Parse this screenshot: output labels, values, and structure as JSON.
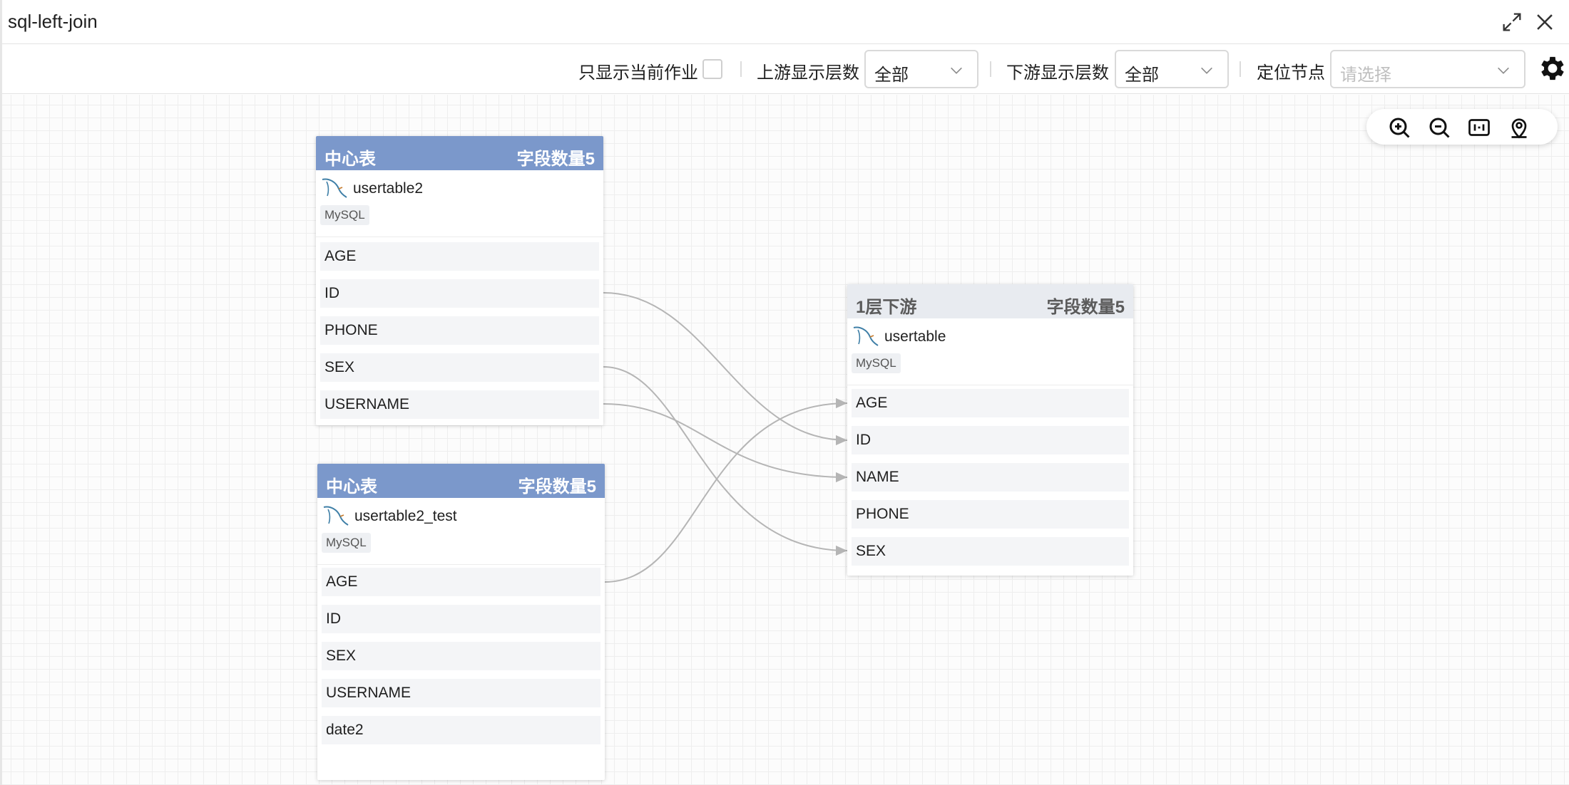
{
  "window": {
    "title": "sql-left-join"
  },
  "toolbar": {
    "only_current_job_label": "只显示当前作业",
    "only_current_job_checked": false,
    "upstream_levels_label": "上游显示层数",
    "upstream_levels_value": "全部",
    "downstream_levels_label": "下游显示层数",
    "downstream_levels_value": "全部",
    "locate_node_label": "定位节点",
    "locate_node_placeholder": "请选择"
  },
  "icons": {
    "fullscreen": "expand-icon",
    "close": "close-icon",
    "settings": "gear-icon",
    "zoom_in": "zoom-in-icon",
    "zoom_out": "zoom-out-icon",
    "fit": "fit-view-icon",
    "locate": "location-pin-icon",
    "db": "mysql-dolphin-icon"
  },
  "colors": {
    "center_header": "#7b98cb",
    "downstream_header": "#e8ebf0",
    "edge": "#b5b5b5"
  },
  "nodes": [
    {
      "role_label": "中心表",
      "field_count_label": "字段数量5",
      "table_name": "usertable2",
      "db_type": "MySQL",
      "fields": [
        "AGE",
        "ID",
        "PHONE",
        "SEX",
        "USERNAME"
      ]
    },
    {
      "role_label": "中心表",
      "field_count_label": "字段数量5",
      "table_name": "usertable2_test",
      "db_type": "MySQL",
      "fields": [
        "AGE",
        "ID",
        "SEX",
        "USERNAME",
        "date2"
      ]
    },
    {
      "role_label": "1层下游",
      "field_count_label": "字段数量5",
      "table_name": "usertable",
      "db_type": "MySQL",
      "fields": [
        "AGE",
        "ID",
        "NAME",
        "PHONE",
        "SEX"
      ]
    }
  ],
  "edges": [
    {
      "from": "usertable2.ID",
      "to": "usertable.ID"
    },
    {
      "from": "usertable2.SEX",
      "to": "usertable.SEX"
    },
    {
      "from": "usertable2.USERNAME",
      "to": "usertable.NAME"
    },
    {
      "from": "usertable2_test.AGE",
      "to": "usertable.AGE"
    }
  ]
}
